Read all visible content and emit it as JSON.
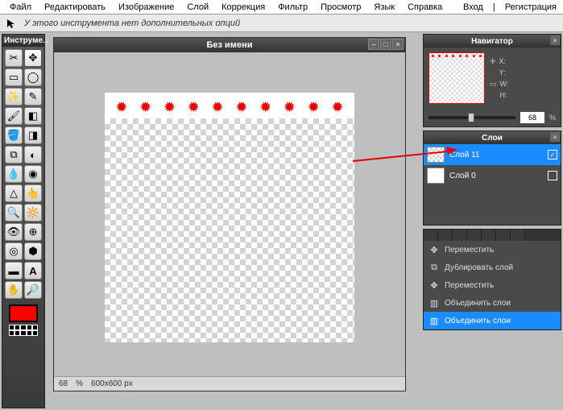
{
  "menu": {
    "file": "Файл",
    "edit": "Редактировать",
    "image": "Изображение",
    "layer": "Слой",
    "adjust": "Коррекция",
    "filter": "Фильтр",
    "view": "Просмотр",
    "lang": "Язык",
    "help": "Справка",
    "login": "Вход",
    "sep": "|",
    "register": "Регистрация"
  },
  "optbar": {
    "text": "У этого инструмента нет дополнительных опций"
  },
  "toolbox": {
    "title": "Инструме..."
  },
  "doc": {
    "title": "Без имени",
    "zoom": "68",
    "zoom_unit": "%",
    "dims": "600x600 px"
  },
  "navigator": {
    "title": "Навигатор",
    "x_label": "X:",
    "y_label": "Y:",
    "w_label": "W:",
    "h_label": "H:",
    "zoom": "68",
    "zoom_unit": "%"
  },
  "layers": {
    "title": "Слои",
    "items": [
      {
        "name": "Слой 11",
        "selected": true,
        "checked": true,
        "transparent": true
      },
      {
        "name": "Слой 0",
        "selected": false,
        "checked": false,
        "transparent": false
      }
    ]
  },
  "history": {
    "items": [
      {
        "label": "Переместить",
        "selected": false
      },
      {
        "label": "Дублировать слой",
        "selected": false
      },
      {
        "label": "Переместить",
        "selected": false
      },
      {
        "label": "Объединить слои",
        "selected": false
      },
      {
        "label": "Объединить слои",
        "selected": true
      }
    ]
  },
  "colors": {
    "foreground": "#ff0000"
  }
}
